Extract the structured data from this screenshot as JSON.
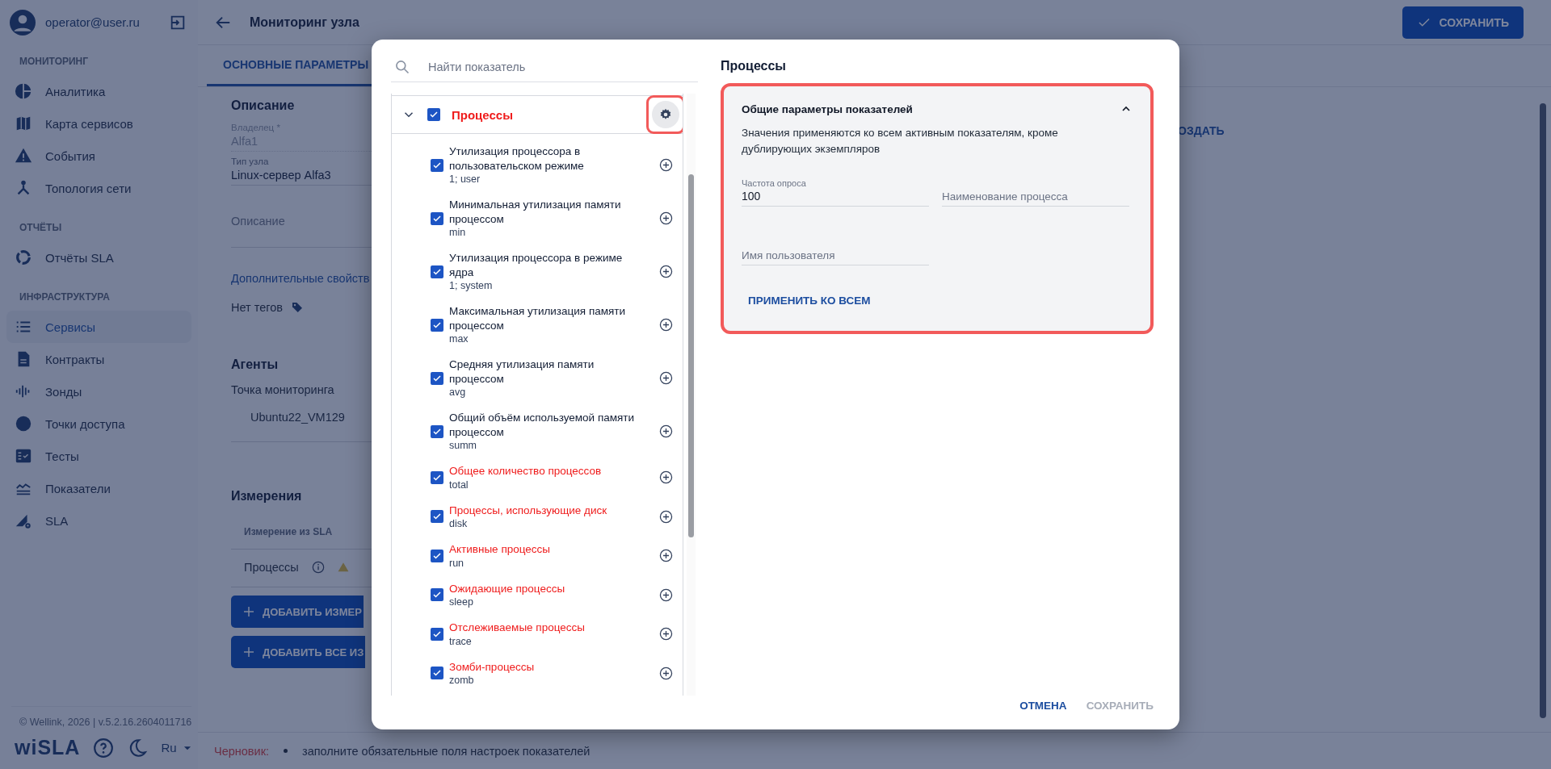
{
  "sidebar": {
    "user": "operator@user.ru",
    "sections": [
      {
        "title": "МОНИТОРИНГ",
        "items": [
          {
            "label": "Аналитика",
            "selected": false
          },
          {
            "label": "Карта сервисов",
            "selected": false
          },
          {
            "label": "События",
            "selected": false
          },
          {
            "label": "Топология сети",
            "selected": false
          }
        ]
      },
      {
        "title": "ОТЧЁТЫ",
        "items": [
          {
            "label": "Отчёты SLA",
            "selected": false
          }
        ]
      },
      {
        "title": "ИНФРАСТРУКТУРА",
        "items": [
          {
            "label": "Сервисы",
            "selected": true
          },
          {
            "label": "Контракты",
            "selected": false
          },
          {
            "label": "Зонды",
            "selected": false
          },
          {
            "label": "Точки доступа",
            "selected": false
          },
          {
            "label": "Тесты",
            "selected": false
          },
          {
            "label": "Показатели",
            "selected": false
          },
          {
            "label": "SLA",
            "selected": false
          }
        ]
      }
    ],
    "copyright": "© Wellink, 2026 | v.5.2.16.2604011716",
    "logo": "wiSLA",
    "language": "Ru"
  },
  "header": {
    "title": "Мониторинг узла",
    "save_button": "СОХРАНИТЬ"
  },
  "tabs": [
    {
      "label": "ОСНОВНЫЕ ПАРАМЕТРЫ",
      "selected": true
    }
  ],
  "form": {
    "description_heading": "Описание",
    "fields": [
      {
        "label": "Владелец *",
        "value": "Alfa1",
        "disabled": true
      },
      {
        "label": "Тип узла",
        "value": "Linux-сервер Alfa3",
        "disabled": false
      },
      {
        "placeholder": "Описание",
        "disabled": false
      }
    ],
    "extra_link": "Дополнительные свойств",
    "tags": "Нет тегов",
    "agents_heading": "Агенты",
    "monitoring_point_label": "Точка мониторинга",
    "monitoring_point": "Ubuntu22_VM129",
    "measurements_heading": "Измерения",
    "table": {
      "columns": [
        "Измерение из SLA"
      ],
      "rows": [
        {
          "name": "Процессы"
        }
      ]
    },
    "buttons": [
      "ДОБАВИТЬ ИЗМЕР",
      "ДОБАВИТЬ ВСЕ ИЗ"
    ],
    "create_link": "ОЗДАТЬ"
  },
  "status_bar": {
    "label": "Черновик:",
    "messages": [
      "заполните обязательные поля настроек показателей"
    ]
  },
  "dialog": {
    "search": {
      "placeholder": "Найти показатель"
    },
    "group": {
      "label": "Процессы",
      "checked": true,
      "expanded": true,
      "error": true,
      "settings_highlighted": true,
      "items": [
        {
          "name": "Утилизация процессора в пользовательском режиме",
          "sub": "1; user",
          "checked": true,
          "error": false
        },
        {
          "name": "Минимальная утилизация памяти процессом",
          "sub": "min",
          "checked": true,
          "error": false
        },
        {
          "name": "Утилизация процессора в режиме ядра",
          "sub": "1; system",
          "checked": true,
          "error": false
        },
        {
          "name": "Максимальная утилизация памяти процессом",
          "sub": "max",
          "checked": true,
          "error": false
        },
        {
          "name": "Средняя утилизация памяти процессом",
          "sub": "avg",
          "checked": true,
          "error": false
        },
        {
          "name": "Общий объём используемой памяти процессом",
          "sub": "summ",
          "checked": true,
          "error": false
        },
        {
          "name": "Общее количество процессов",
          "sub": "total",
          "checked": true,
          "error": true
        },
        {
          "name": "Процессы, использующие диск",
          "sub": "disk",
          "checked": true,
          "error": true
        },
        {
          "name": "Активные процессы",
          "sub": "run",
          "checked": true,
          "error": true
        },
        {
          "name": "Ожидающие процессы",
          "sub": "sleep",
          "checked": true,
          "error": true
        },
        {
          "name": "Отслеживаемые процессы",
          "sub": "trace",
          "checked": true,
          "error": true
        },
        {
          "name": "Зомби-процессы",
          "sub": "zomb",
          "checked": true,
          "error": true
        }
      ]
    },
    "panel_title": "Процессы",
    "card": {
      "title": "Общие параметры показателей",
      "expanded": true,
      "highlighted": true,
      "description": "Значения применяются ко всем активным показателям, кроме дублирующих экземпляров",
      "fields": [
        {
          "label": "Частота опроса",
          "value": "100"
        },
        {
          "placeholder": "Наименование процесса"
        },
        {
          "placeholder": "Имя пользователя"
        }
      ],
      "apply_button": "ПРИМЕНИТЬ КО ВСЕМ"
    },
    "buttons": [
      {
        "label": "ОТМЕНА",
        "disabled": false
      },
      {
        "label": "СОХРАНИТЬ",
        "disabled": true
      }
    ]
  }
}
